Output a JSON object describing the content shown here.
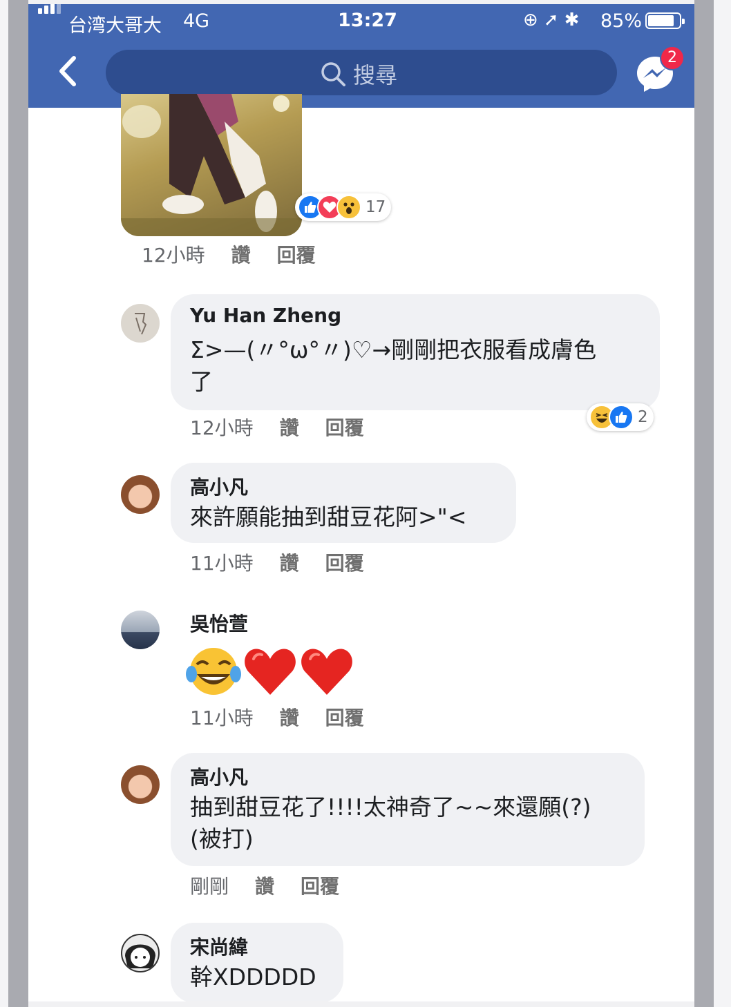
{
  "status_bar": {
    "carrier": "台湾大哥大",
    "network": "4G",
    "time": "13:27",
    "battery": "85%",
    "battery_level": 0.85
  },
  "nav": {
    "search_placeholder": "搜尋",
    "messenger_badge": "2"
  },
  "colors": {
    "brand": "#4267b2",
    "bubble": "#f0f1f4",
    "like": "#1877f2",
    "love": "#f33e58"
  },
  "post": {
    "reaction_icons": [
      "like-icon",
      "love-icon",
      "wow-icon"
    ],
    "reaction_count": "17",
    "time": "12小時",
    "like_label": "讚",
    "reply_label": "回覆"
  },
  "comments": [
    {
      "name": "Yu Han Zheng",
      "text_line1": "Σ>—(〃°ω°〃)♡→剛剛把衣服看成膚色",
      "text_line2": "了",
      "time": "12小時",
      "like_label": "讚",
      "reply_label": "回覆",
      "reaction_icons": [
        "haha-icon",
        "like-icon"
      ],
      "reaction_count": "2"
    },
    {
      "name": "高小凡",
      "text_line1": "來許願能抽到甜豆花阿>\"<",
      "time": "11小時",
      "like_label": "讚",
      "reply_label": "回覆"
    },
    {
      "name": "吳怡萱",
      "emoji": "😂❤️❤️",
      "time": "11小時",
      "like_label": "讚",
      "reply_label": "回覆"
    },
    {
      "name": "高小凡",
      "text_line1": "抽到甜豆花了!!!!太神奇了~~來還願(?)",
      "text_line2": "(被打)",
      "time": "剛剛",
      "like_label": "讚",
      "reply_label": "回覆"
    },
    {
      "name": "宋尚緯",
      "text_line1": "幹XDDDDD"
    }
  ]
}
